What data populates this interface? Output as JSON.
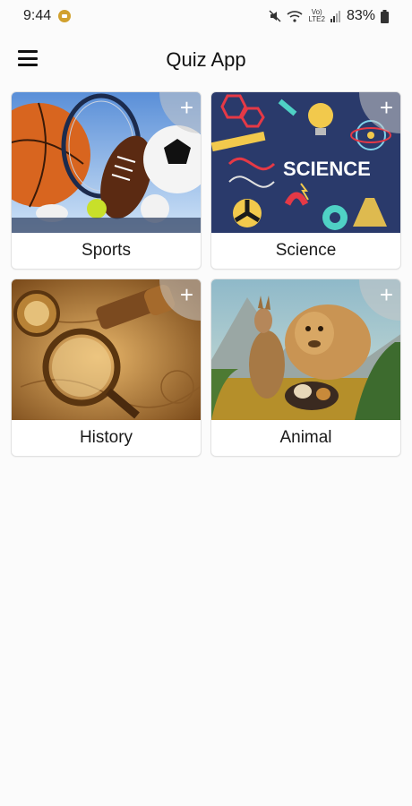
{
  "status_bar": {
    "time": "9:44",
    "volte": "Vo)",
    "lte": "LTE2",
    "battery": "83%"
  },
  "app_bar": {
    "title": "Quiz App"
  },
  "categories": [
    {
      "label": "Sports",
      "image_icon": "sports-image",
      "add_symbol": "+"
    },
    {
      "label": "Science",
      "image_icon": "science-image",
      "add_symbol": "+"
    },
    {
      "label": "History",
      "image_icon": "history-image",
      "add_symbol": "+"
    },
    {
      "label": "Animal",
      "image_icon": "animal-image",
      "add_symbol": "+"
    }
  ],
  "colors": {
    "background": "#fbfbfb",
    "notification": "#d1a12e",
    "science_bg": "#2a3a6b"
  }
}
